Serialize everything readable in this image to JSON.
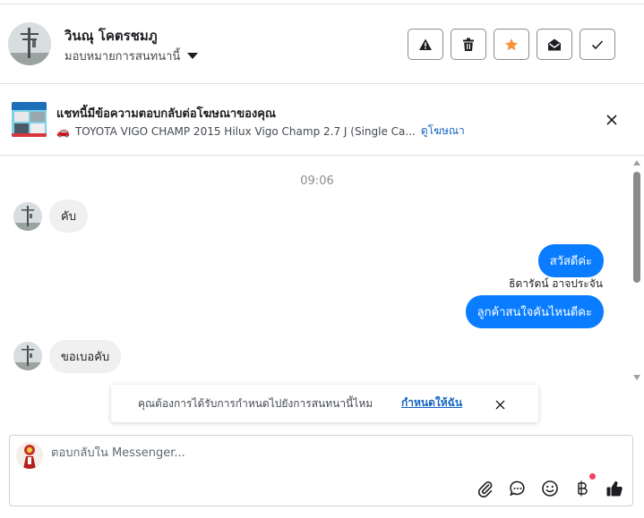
{
  "header": {
    "contact_name": "วินณุ โคตรชมภู",
    "assign_label": "มอบหมายการสนทนานี้",
    "actions": [
      "warning-icon",
      "trash-icon",
      "star-icon",
      "mail-open-icon",
      "check-icon"
    ],
    "star_color": "#f7923b"
  },
  "ad": {
    "title": "แชทนี้มีข้อความตอบกลับต่อโฆษณาของคุณ",
    "vehicle_emoji": "🚗",
    "product": "TOYOTA VIGO CHAMP 2015 Hilux Vigo Champ 2.7 J (Single Ca...",
    "link": "ดูโฆษณา"
  },
  "conversation": {
    "timestamp": "09:06",
    "messages": [
      {
        "dir": "in",
        "text": "คับ"
      },
      {
        "dir": "out",
        "text": "สวัสดีค่ะ"
      },
      {
        "dir": "out",
        "text": "ลูกค้าสนใจคันไหนดีคะ",
        "sender": "ธิดารัตน์ อาจประจัน"
      },
      {
        "dir": "in",
        "text": "ขอเบอคับ"
      }
    ],
    "outgoing_color": "#0a7cff",
    "incoming_color": "#f0f0f0"
  },
  "toast": {
    "text": "คุณต้องการได้รับการกำหนดไปยังการสนทนานี้ไหม",
    "link": "กำหนดให้ฉัน"
  },
  "composer": {
    "placeholder": "ตอบกลับใน Messenger...",
    "tools": [
      "paperclip-icon",
      "chat-bubble-icon",
      "emoji-icon",
      "baht-icon",
      "thumbs-up-icon"
    ]
  }
}
